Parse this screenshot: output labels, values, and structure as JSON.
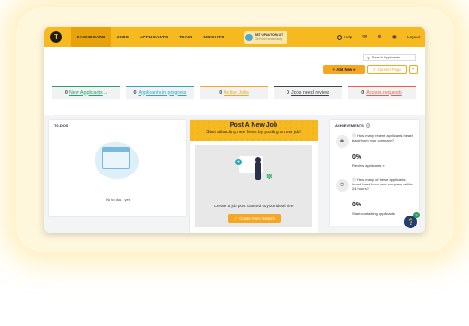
{
  "nav": {
    "items": [
      "DASHBOARD",
      "JOBS",
      "APPLICANTS",
      "TEAM",
      "INSIGHTS"
    ],
    "autopilot": {
      "title": "SET UP AUTOPILOT",
      "subtitle": "Get hired seamlessly"
    },
    "help_label": "Help",
    "logout_label": "Logout"
  },
  "toolbar": {
    "search_label": "Search Applicants",
    "add_new_label": "Add New",
    "career_page_label": "Careers Page"
  },
  "stats": [
    {
      "num": "0",
      "label": "New Applicants",
      "arrow": "→",
      "color": "#26a36b"
    },
    {
      "num": "0",
      "label": "Applicants in progress",
      "arrow": "",
      "color": "#36a3c4"
    },
    {
      "num": "0",
      "label": "Active Jobs",
      "arrow": "",
      "color": "#f5a623"
    },
    {
      "num": "0",
      "label": "Jobs need review",
      "arrow": "",
      "color": "#444444"
    },
    {
      "num": "0",
      "label": "Access requests",
      "arrow": "",
      "color": "#e8604c"
    }
  ],
  "todos": {
    "title": "TO-DOS",
    "empty_text": "No to dos . yet"
  },
  "post_job": {
    "title": "Post A New Job",
    "subtitle": "Start attracting new hires by posting a new job!",
    "body_text": "Create a job post catered to your ideal hire",
    "button_label": "Create From Scratch"
  },
  "achievements": {
    "title": "ACHIEVEMENTS",
    "items": [
      {
        "question": "How many recent applicants heard back from your company?",
        "pct": "0%",
        "link": "Review applicants »"
      },
      {
        "question": "How many of these applicants heard back from your company within 24 hours?",
        "pct": "0%",
        "link": "Start contacting applicants"
      }
    ]
  },
  "help_badge": "3"
}
